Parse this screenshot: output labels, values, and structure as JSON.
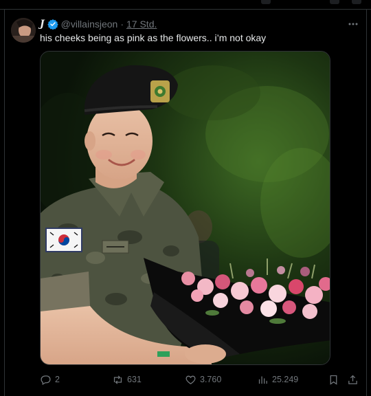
{
  "tweet": {
    "display_name": "J",
    "handle": "@villainsjeon",
    "separator": "·",
    "timestamp": "17 Std.",
    "text": "his cheeks being as pink as the flowers.. i’m not okay",
    "verified_color": "#1d9bf0"
  },
  "media": {
    "alt_subject": "person in military uniform holding pink flower bouquet"
  },
  "actions": {
    "replies": "2",
    "reposts": "631",
    "likes": "3.760",
    "views": "25.249"
  },
  "icons": [
    "more-icon",
    "reply-icon",
    "repost-icon",
    "like-icon",
    "views-icon",
    "bookmark-icon",
    "share-icon",
    "verified-icon"
  ],
  "colors": {
    "background": "#000000",
    "text": "#e7e9ea",
    "muted": "#71767b",
    "border": "#2f3336",
    "accent": "#1d9bf0"
  }
}
